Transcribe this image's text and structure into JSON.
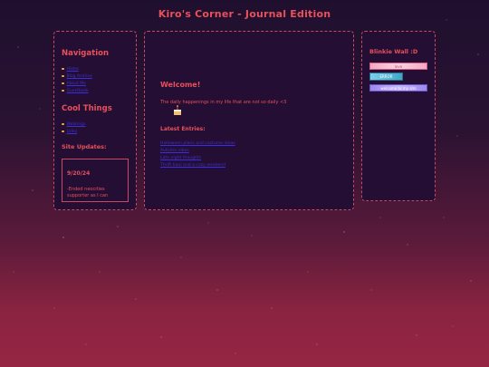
{
  "page": {
    "title": "Kiro's Corner - Journal Edition"
  },
  "sidebar_left": {
    "navigation_heading": "Navigation",
    "navigation_items": [
      "Home",
      "Blog Archive",
      "About Me",
      "Guestbook"
    ],
    "cool_things_heading": "Cool Things",
    "cool_things_items": [
      "Webrings",
      "Links"
    ],
    "site_updates_heading": "Site Updates:",
    "update_date": "9/20/24",
    "update_text": "-Ended neocities supporter as I can"
  },
  "main": {
    "welcome_heading": "Welcome!",
    "tagline": "The daily happenings in my life that are not so daily <3",
    "latest_heading": "Latest Entries:",
    "entries": [
      "Halloween plans and costume ideas",
      "Autumn vibes",
      "Late night thoughts",
      "Thrift haul and a cozy weekend"
    ]
  },
  "sidebar_right": {
    "heading": "Blinkie Wall :D",
    "blinkies": [
      "love",
      "ERROR",
      "welcome to my site"
    ]
  },
  "colors": {
    "accent": "#e8505a",
    "panel_bg": "#250e34",
    "link": "#3a2fd8",
    "bullet": "#f2b13c"
  }
}
